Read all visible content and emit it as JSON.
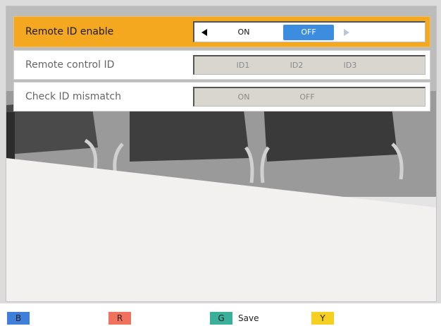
{
  "menu": {
    "rows": [
      {
        "label": "Remote ID enable",
        "options": [
          "ON",
          "OFF"
        ],
        "selected_value": "OFF",
        "focused": true
      },
      {
        "label": "Remote control ID",
        "options": [
          "ID1",
          "ID2",
          "ID3"
        ],
        "enabled": false
      },
      {
        "label": "Check ID mismatch",
        "options": [
          "ON",
          "OFF"
        ],
        "enabled": false
      }
    ]
  },
  "footer": {
    "keys": [
      {
        "key": "B",
        "color": "#3f7fd9",
        "action": ""
      },
      {
        "key": "R",
        "color": "#f0725c",
        "action": ""
      },
      {
        "key": "G",
        "color": "#3ab09a",
        "action": "Save"
      },
      {
        "key": "Y",
        "color": "#f5d020",
        "action": ""
      }
    ]
  },
  "colors": {
    "highlight_row": "#f3a820",
    "active_option": "#3c8de0"
  }
}
